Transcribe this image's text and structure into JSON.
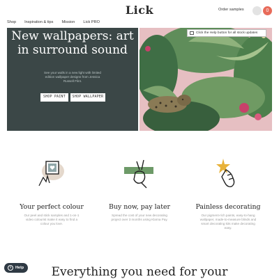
{
  "header": {
    "logo": "Lick",
    "order_samples": "Order samples",
    "cart_count": "0"
  },
  "nav": {
    "items": [
      "Shop",
      "Inspiration & tips",
      "Mission",
      "Lick PRO"
    ]
  },
  "hero": {
    "title": "New wallpapers: art in surround sound",
    "subtitle": "See your walls in a new light with limited edition wallpaper designs from Jessica Russell Flint.",
    "btn_paint": "SHOP PAINT",
    "btn_wallpaper": "SHOP WALLPAPER"
  },
  "notice": {
    "text": "Click the Help button for all stock updates"
  },
  "features": [
    {
      "title": "Your perfect colour",
      "desc": "Our peel and stick samples and 1-on-1 video colourist make it easy to find a colour you love.",
      "icon": "heart-sample-icon"
    },
    {
      "title": "Buy now, pay later",
      "desc": "Spread the cost of your new decorating project over 3 months using Klarna Pay.",
      "icon": "peace-hand-icon"
    },
    {
      "title": "Painless decorating",
      "desc": "Our pigment-rich paints, easy-to-hang wallpaper, made-to-measure blinds and smart decorating kits make decorating easy.",
      "icon": "sparkle-hand-icon"
    }
  ],
  "help": {
    "label": "Help"
  },
  "bottom": {
    "heading": "Everything you need for your"
  },
  "colors": {
    "hero_bg": "#3b4747",
    "accent_red": "#e86b5a",
    "help_bg": "#2f3a44"
  }
}
